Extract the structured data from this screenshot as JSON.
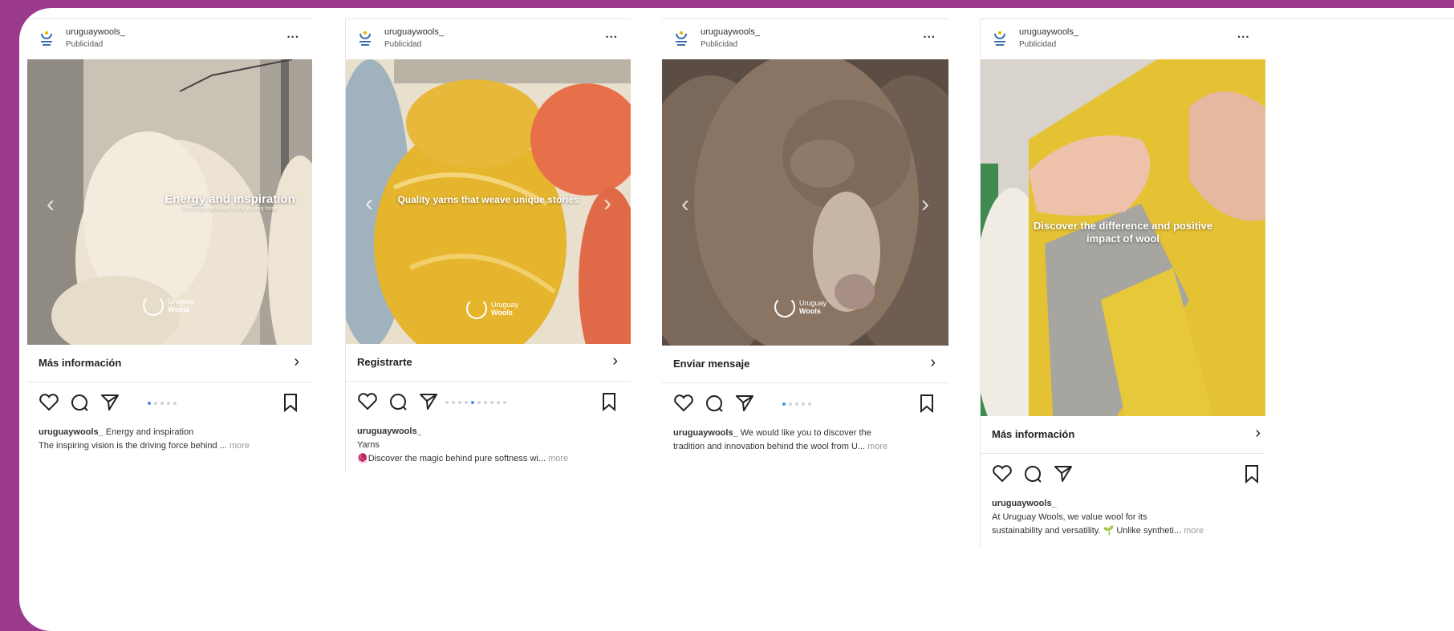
{
  "colors": {
    "background": "#9b3a8c",
    "panel": "#ffffff",
    "dot_active": "#4a90e2"
  },
  "posts": [
    {
      "username": "uruguaywools_",
      "subtitle": "Publicidad",
      "menu": "...",
      "overlay_title": "Energy and inspiration",
      "overlay_sub": "The inspiring vision is the driving force",
      "logo_line1": "Uruguay",
      "logo_line2": "Wools",
      "cta": "Más información",
      "caption_user": "uruguaywools_",
      "caption_line1": "Energy and inspiration",
      "caption_line2": "The inspiring vision is the driving force behind ...",
      "more": "more",
      "dots_total": 5,
      "dots_active": 0
    },
    {
      "username": "uruguaywools_",
      "subtitle": "Publicidad",
      "menu": "...",
      "overlay_title": "Quality yarns that weave unique stories",
      "logo_line1": "Uruguay",
      "logo_line2": "Wools",
      "cta": "Registrarte",
      "caption_user": "uruguaywools_",
      "caption_line1": "Yarns",
      "caption_line2": "🧶Discover the magic behind pure softness wi...",
      "more": "more",
      "dots_total": 10,
      "dots_active": 4
    },
    {
      "username": "uruguaywools_",
      "subtitle": "Publicidad",
      "menu": "...",
      "overlay_title": "",
      "logo_line1": "Uruguay",
      "logo_line2": "Wools",
      "cta": "Enviar mensaje",
      "caption_user": "uruguaywools_",
      "caption_line1": "We would like you to discover the",
      "caption_line2": "tradition and innovation behind the wool from U...",
      "more": "more",
      "dots_total": 5,
      "dots_active": 0
    },
    {
      "username": "uruguaywools_",
      "subtitle": "Publicidad",
      "menu": "...",
      "overlay_title": "Discover the difference and positive impact of wool",
      "cta": "Más información",
      "caption_user": "uruguaywools_",
      "caption_line1": "At Uruguay Wools, we value wool for its",
      "caption_line2": "sustainability and versatility. 🌱 Unlike syntheti...",
      "more": "more"
    }
  ]
}
